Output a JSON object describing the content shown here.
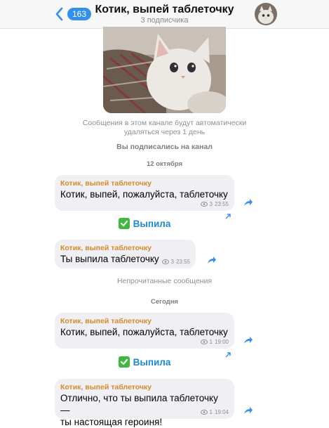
{
  "header": {
    "back_count": "163",
    "title": "Котик, выпей таблеточку",
    "subtitle": "3 подписчика"
  },
  "system": {
    "autodelete_line1": "Сообщения в этом канале будут автоматически",
    "autodelete_line2": "удаляться через 1 день",
    "subscribed": "Вы подписались на канал",
    "date1": "12 октября",
    "unread": "Непрочитанные сообщения",
    "date2": "Сегодня"
  },
  "messages": [
    {
      "sender": "Котик, выпей таблеточку",
      "text": "Котик, выпей, пожалуйста, таблеточку",
      "views": "3",
      "time": "23:55"
    },
    {
      "sender": "Котик, выпей таблеточку",
      "text": "Ты выпила таблеточку",
      "views": "3",
      "time": "23:55"
    },
    {
      "sender": "Котик, выпей таблеточку",
      "text": "Котик, выпей, пожалуйста, таблеточку",
      "views": "1",
      "time": "19:00"
    },
    {
      "sender": "Котик, выпей таблеточку",
      "text_line1": "Отлично, что ты выпила таблеточку —",
      "text_line2": "ты настоящая героиня!",
      "views": "1",
      "time": "19:04"
    }
  ],
  "buttons": [
    {
      "label": "Выпила"
    },
    {
      "label": "Выпила"
    }
  ],
  "colors": {
    "accent": "#3390ec",
    "sender": "#d38b2b",
    "bubble": "#efeff4",
    "check": "#3fb83f"
  },
  "icons": [
    "chevron-left-icon",
    "eye-icon",
    "share-arrow-icon",
    "check-mark-icon",
    "external-arrow-icon"
  ]
}
